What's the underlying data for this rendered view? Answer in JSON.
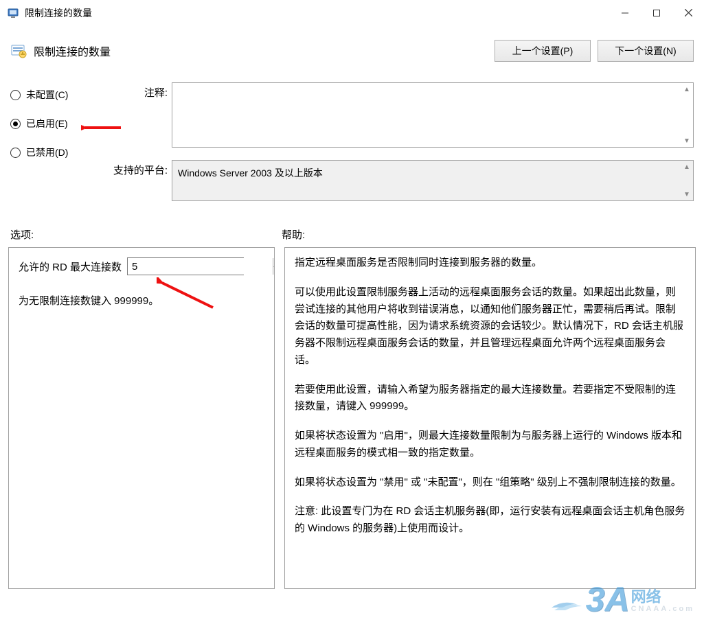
{
  "window": {
    "title": "限制连接的数量"
  },
  "header": {
    "policy_title": "限制连接的数量",
    "prev_btn": "上一个设置(P)",
    "next_btn": "下一个设置(N)"
  },
  "radios": {
    "not_configured": "未配置(C)",
    "enabled": "已启用(E)",
    "disabled": "已禁用(D)",
    "selected": "enabled"
  },
  "fields": {
    "comment_label": "注释:",
    "comment_value": "",
    "platform_label": "支持的平台:",
    "platform_value": "Windows Server 2003 及以上版本"
  },
  "sections": {
    "options_label": "选项:",
    "help_label": "帮助:"
  },
  "options": {
    "max_rd_label": "允许的 RD 最大连接数",
    "max_rd_value": "5",
    "unlimited_hint": "为无限制连接数键入 999999。"
  },
  "help_paragraphs": [
    "指定远程桌面服务是否限制同时连接到服务器的数量。",
    "可以使用此设置限制服务器上活动的远程桌面服务会话的数量。如果超出此数量，则尝试连接的其他用户将收到错误消息，以通知他们服务器正忙，需要稍后再试。限制会话的数量可提高性能，因为请求系统资源的会话较少。默认情况下，RD 会话主机服务器不限制远程桌面服务会话的数量，并且管理远程桌面允许两个远程桌面服务会话。",
    "若要使用此设置，请输入希望为服务器指定的最大连接数量。若要指定不受限制的连接数量，请键入 999999。",
    "如果将状态设置为 \"启用\"，则最大连接数量限制为与服务器上运行的 Windows 版本和远程桌面服务的模式相一致的指定数量。",
    "如果将状态设置为 \"禁用\" 或 \"未配置\"，则在 \"组策略\" 级别上不强制限制连接的数量。",
    "注意: 此设置专门为在 RD 会话主机服务器(即，运行安装有远程桌面会话主机角色服务的 Windows 的服务器)上使用而设计。"
  ],
  "watermark": {
    "brand_big": "3A",
    "brand_cn": "网络",
    "brand_sub": "CNAAA.com"
  }
}
